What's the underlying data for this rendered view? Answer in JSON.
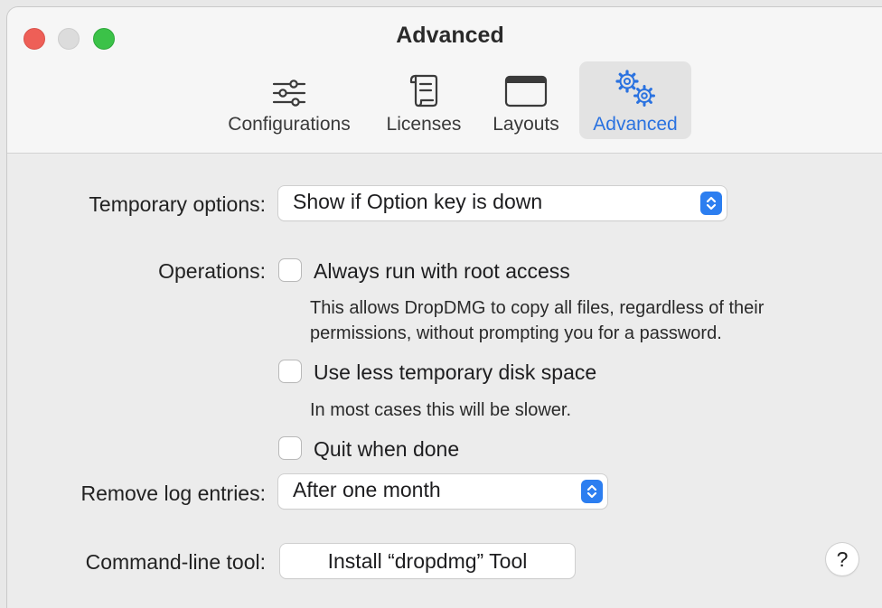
{
  "window": {
    "title": "Advanced"
  },
  "toolbar": {
    "tabs": [
      {
        "label": "Configurations",
        "icon": "sliders-icon"
      },
      {
        "label": "Licenses",
        "icon": "scroll-icon"
      },
      {
        "label": "Layouts",
        "icon": "window-icon"
      },
      {
        "label": "Advanced",
        "icon": "gears-icon",
        "active": true
      }
    ]
  },
  "settings": {
    "temporary_options": {
      "label": "Temporary options:",
      "value": "Show if Option key is down"
    },
    "operations": {
      "label": "Operations:",
      "options": [
        {
          "label": "Always run with root access",
          "checked": false,
          "help": [
            "This allows DropDMG to copy all files, regardless of their",
            "permissions, without prompting you for a password."
          ]
        },
        {
          "label": "Use less temporary disk space",
          "checked": false,
          "help": [
            "In most cases this will be slower."
          ]
        },
        {
          "label": "Quit when done",
          "checked": false
        }
      ]
    },
    "remove_log_entries": {
      "label": "Remove log entries:",
      "value": "After one month"
    },
    "command_line_tool": {
      "label": "Command-line tool:",
      "button": "Install “dropdmg” Tool"
    },
    "help_button": "?"
  },
  "colors": {
    "accent": "#2c7ef0",
    "active_tab_text": "#2a72e0",
    "close": "#ee5f57",
    "minimize": "#dcdcdc",
    "zoom": "#3bc248"
  }
}
